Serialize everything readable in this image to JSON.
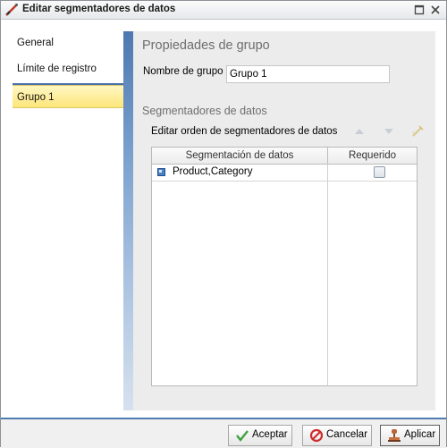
{
  "window": {
    "title": "Editar segmentadores de datos"
  },
  "sidebar": {
    "items": [
      {
        "label": "General"
      },
      {
        "label": "Límite de registro"
      },
      {
        "label": "Grupo 1"
      }
    ]
  },
  "group_properties": {
    "heading": "Propiedades de grupo",
    "name_label": "Nombre de grupo",
    "name_value": "Grupo 1"
  },
  "slicers": {
    "heading": "Segmentadores de datos",
    "edit_order_label": "Editar orden de segmentadores de datos",
    "columns": [
      "Segmentación de datos",
      "Requerido"
    ],
    "rows": [
      {
        "name": "Product,Category",
        "required": false
      }
    ]
  },
  "buttons": {
    "accept": "Aceptar",
    "cancel": "Cancelar",
    "apply": "Aplicar"
  }
}
